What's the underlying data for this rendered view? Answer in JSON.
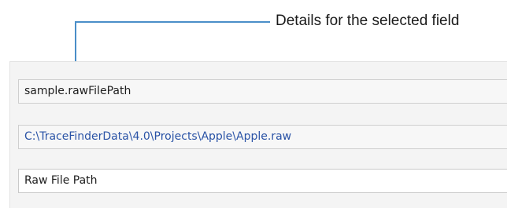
{
  "callout": {
    "label": "Details for the selected field",
    "line_color": "#4a8ec8"
  },
  "details": {
    "field_name": "sample.rawFilePath",
    "field_value": "C:\\TraceFinderData\\4.0\\Projects\\Apple\\Apple.raw",
    "display_name": "Raw File Path"
  },
  "colors": {
    "value_text": "#2a53a6",
    "panel_background": "#f4f4f4"
  }
}
